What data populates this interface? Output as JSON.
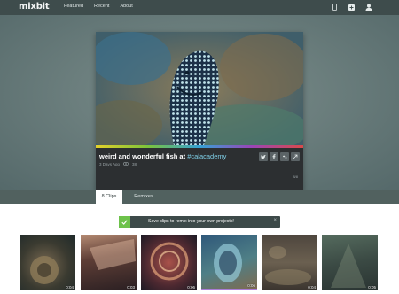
{
  "brand": {
    "logo": "mixbit"
  },
  "nav": {
    "featured": "Featured",
    "recent": "Recent",
    "about": "About"
  },
  "nav_icons": [
    "phone-icon",
    "add-icon",
    "user-icon"
  ],
  "video": {
    "title": "weird and wonderful fish at",
    "hashtag": "#calacademy",
    "age": "3 Days Ago",
    "views": "38",
    "clip_count": "8/8"
  },
  "video_actions": [
    "twitter-icon",
    "facebook-icon",
    "gplus-icon",
    "link-icon"
  ],
  "tabs": {
    "clips": "8 Clips",
    "remixes": "Remixes"
  },
  "notice": {
    "message": "Save clips to remix into your own projects!",
    "close": "×"
  },
  "clips": [
    {
      "duration": "0:04"
    },
    {
      "duration": "0:03"
    },
    {
      "duration": "0:06"
    },
    {
      "duration": "0:06"
    },
    {
      "duration": "0:04"
    },
    {
      "duration": "0:05"
    }
  ],
  "colors": {
    "topbar": "#3e4c4c",
    "accent_green": "#6dc24b",
    "hashtag": "#7fd0e8"
  }
}
